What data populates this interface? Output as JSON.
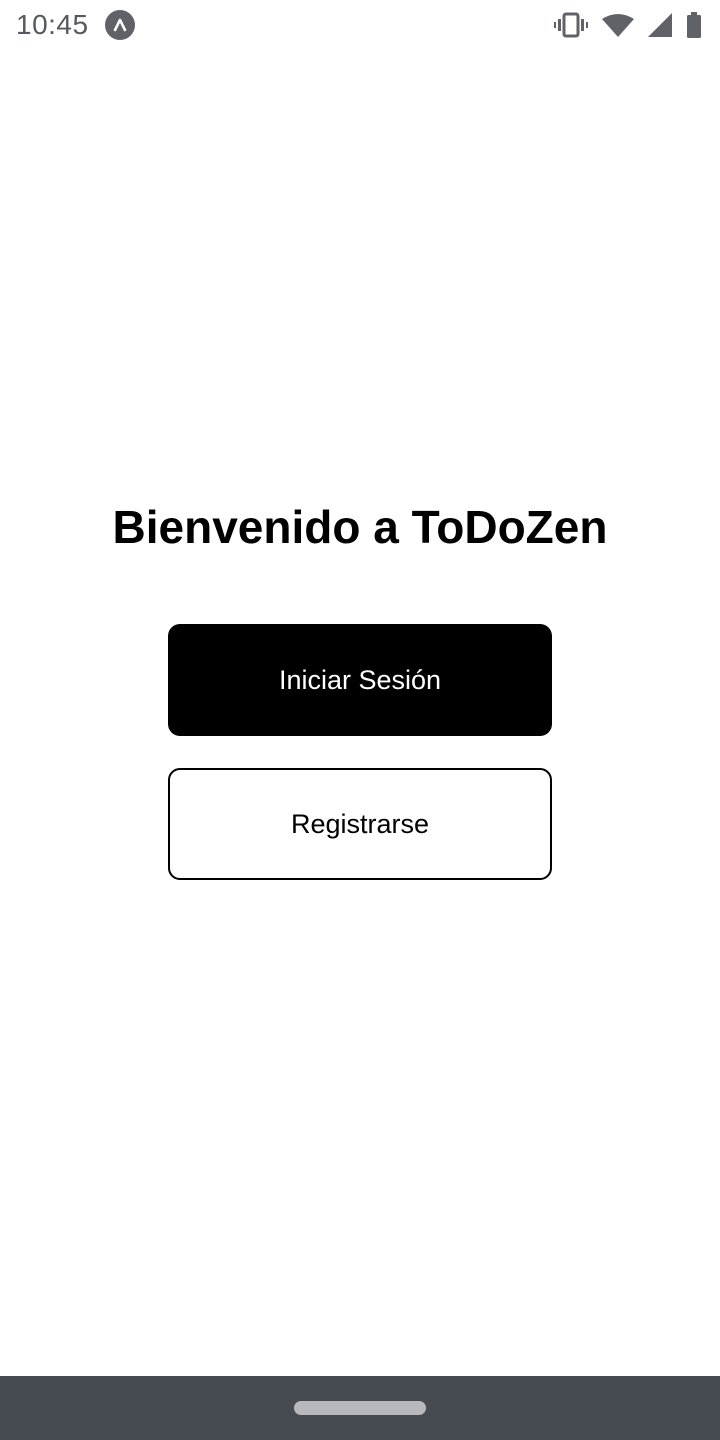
{
  "status_bar": {
    "time": "10:45",
    "icons": [
      "app-notification-icon",
      "vibrate-icon",
      "wifi-icon",
      "cell-signal-icon",
      "battery-icon"
    ]
  },
  "welcome": {
    "title": "Bienvenido a ToDoZen"
  },
  "actions": {
    "login_label": "Iniciar Sesión",
    "register_label": "Registrarse"
  },
  "colors": {
    "primary_button_bg": "#000000",
    "primary_button_text": "#ffffff",
    "nav_bar_bg": "#464a51"
  }
}
